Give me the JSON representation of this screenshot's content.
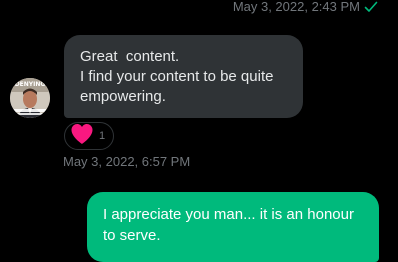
{
  "sent_message": {
    "timestamp": "May 3, 2022, 2:43 PM",
    "status_icon": "check-icon",
    "status_color": "#00ba7c"
  },
  "incoming_message": {
    "lines": [
      "Great  content.",
      "I find your content to be quite",
      "empowering."
    ],
    "avatar_caption": "DENYING",
    "reaction": {
      "icon": "heart-icon",
      "color": "#f91880",
      "count": "1"
    },
    "timestamp": "May 3, 2022, 6:57 PM"
  },
  "outgoing_message": {
    "lines": [
      "I appreciate you man... it is an honour",
      "to serve."
    ],
    "bubble_color": "#00ba7c"
  }
}
